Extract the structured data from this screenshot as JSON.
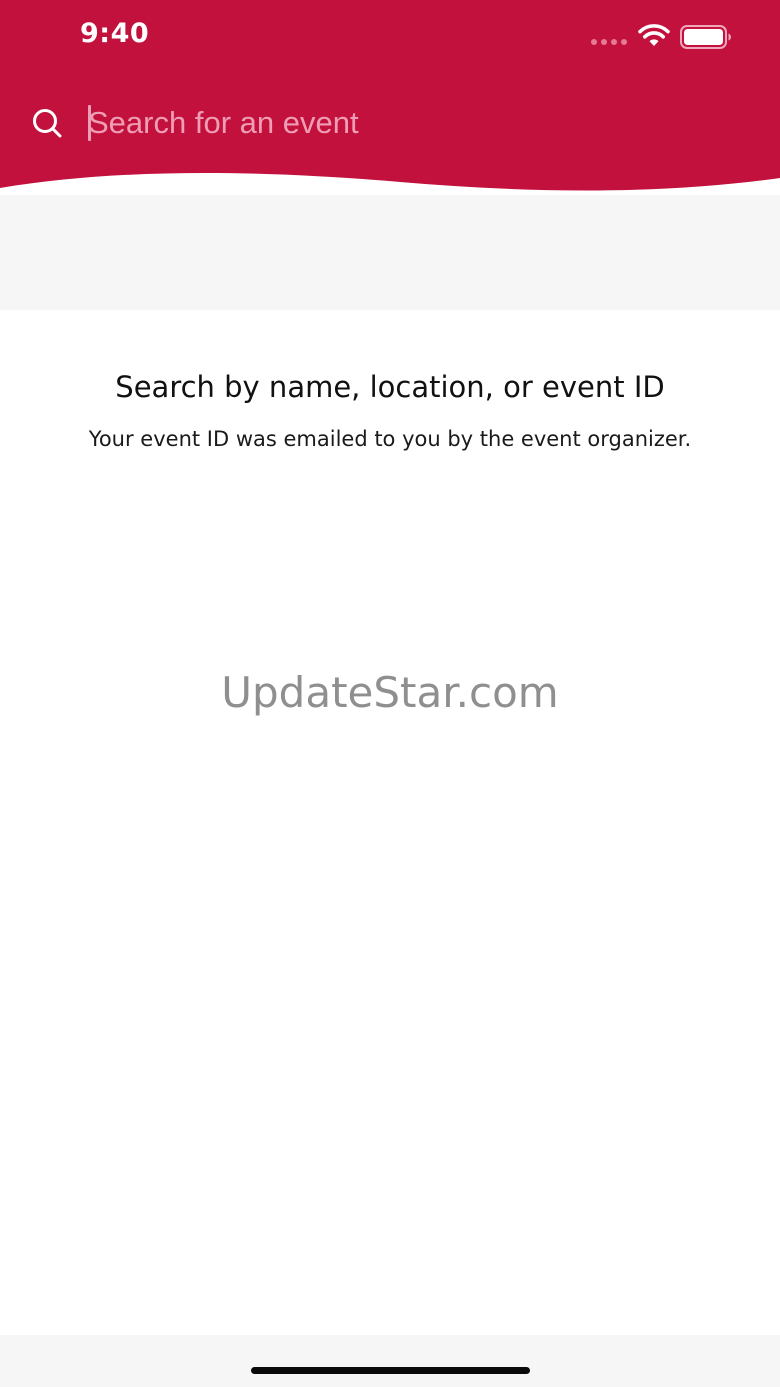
{
  "colors": {
    "header_bg": "#c2113d",
    "placeholder": "#ef9db5",
    "page_bg": "#ffffff",
    "band_bg": "#f6f6f6",
    "watermark": "#8f8f8f"
  },
  "status_bar": {
    "time": "9:40",
    "icons": [
      "cellular-signal-icon",
      "wifi-icon",
      "battery-icon"
    ]
  },
  "search": {
    "icon": "search-icon",
    "placeholder": "Search for an event",
    "value": ""
  },
  "empty_state": {
    "title": "Search by name, location, or event ID",
    "subtitle": "Your event ID was emailed to you by the event organizer."
  },
  "watermark": "UpdateStar.com"
}
